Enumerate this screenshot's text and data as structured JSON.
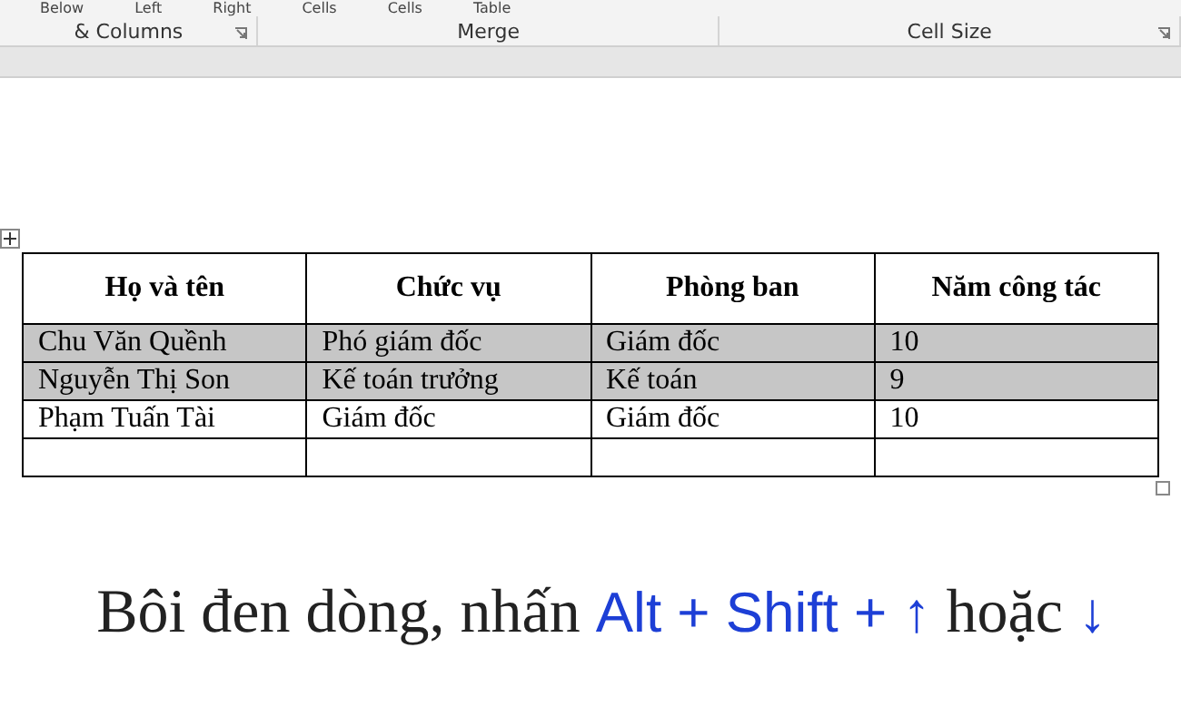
{
  "ribbon": {
    "buttons_cut": [
      "Below",
      "Left",
      "Right",
      "Cells",
      "Cells",
      "Table"
    ],
    "groups": [
      {
        "label": "& Columns",
        "launcher": true
      },
      {
        "label": "Merge",
        "launcher": false
      },
      {
        "label": "Cell Size",
        "launcher": true
      }
    ]
  },
  "table": {
    "columns": [
      "Họ và tên",
      "Chức vụ",
      "Phòng ban",
      "Năm công tác"
    ],
    "rows": [
      {
        "cells": [
          "Chu Văn Quềnh",
          "Phó giám đốc",
          "Giám đốc",
          "10"
        ],
        "selected": true
      },
      {
        "cells": [
          "Nguyễn Thị Son",
          "Kế toán trưởng",
          "Kế toán",
          "9"
        ],
        "selected": true
      },
      {
        "cells": [
          "Phạm Tuấn Tài",
          "Giám đốc",
          "Giám đốc",
          "10"
        ],
        "selected": false
      },
      {
        "cells": [
          "",
          "",
          "",
          ""
        ],
        "selected": false
      }
    ]
  },
  "caption": [
    {
      "kind": "plain",
      "text": "Bôi đen dòng, nhấn "
    },
    {
      "kind": "key",
      "text": "Alt + Shift + ↑"
    },
    {
      "kind": "plain",
      "text": " hoặc "
    },
    {
      "kind": "key",
      "text": "↓"
    }
  ]
}
